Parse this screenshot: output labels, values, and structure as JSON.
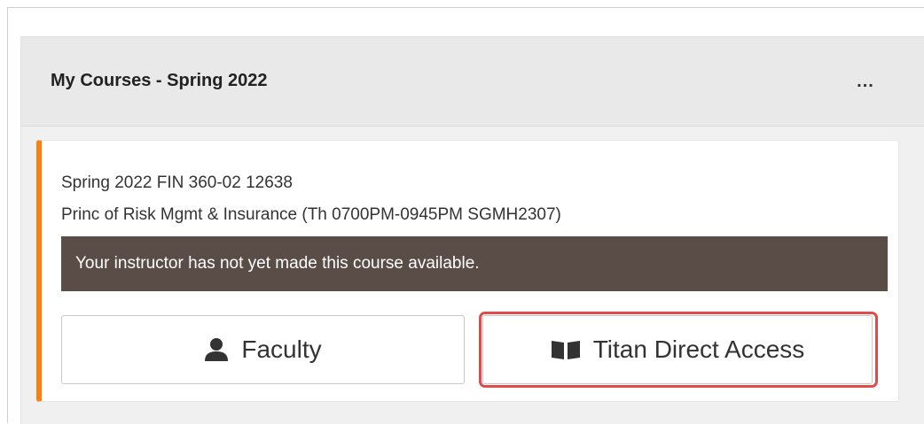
{
  "widget": {
    "title": "My Courses - Spring 2022",
    "menu_label": "..."
  },
  "course": {
    "code": "Spring 2022 FIN 360-02 12638",
    "title": "Princ of Risk Mgmt & Insurance (Th 0700PM-0945PM SGMH2307)",
    "notice": "Your instructor has not yet made this course available.",
    "accent_color": "#ff7f0e",
    "notice_color": "#5a4d48",
    "buttons": [
      {
        "label": "Faculty",
        "icon": "user-icon"
      },
      {
        "label": "Titan Direct Access",
        "icon": "book-icon"
      }
    ],
    "highlight_color": "#e04b4b"
  }
}
